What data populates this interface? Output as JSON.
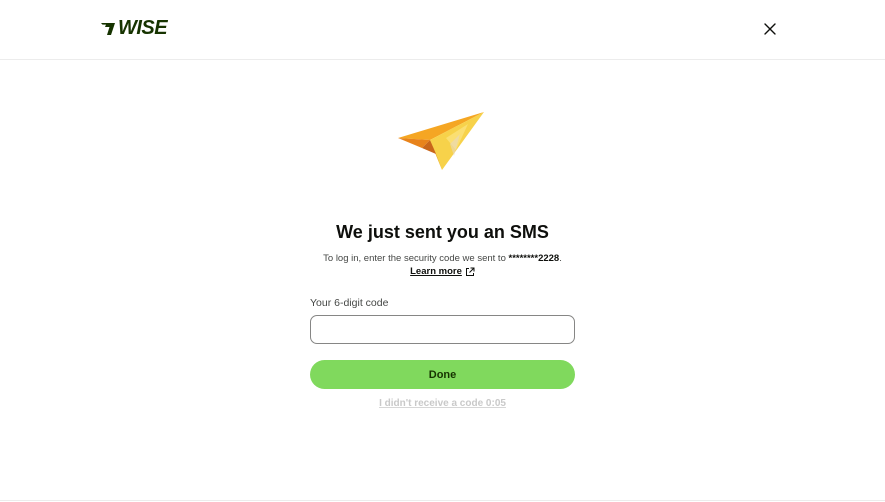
{
  "header": {
    "logo_text": "WISE",
    "close_icon": "close-icon"
  },
  "illustration": {
    "icon": "paper-plane-icon"
  },
  "main": {
    "title": "We just sent you an SMS",
    "subtitle_prefix": "To log in, enter the security code we sent to ",
    "masked_phone": "********2228",
    "subtitle_suffix": ".",
    "learn_more": "Learn more",
    "learn_more_icon": "external-link-icon"
  },
  "form": {
    "code_label": "Your 6-digit code",
    "code_value": "",
    "code_placeholder": "",
    "done_label": "Done",
    "resend_label": "I didn't receive a code 0:05"
  },
  "colors": {
    "brand_green": "#80d95d",
    "brand_dark": "#163300"
  }
}
